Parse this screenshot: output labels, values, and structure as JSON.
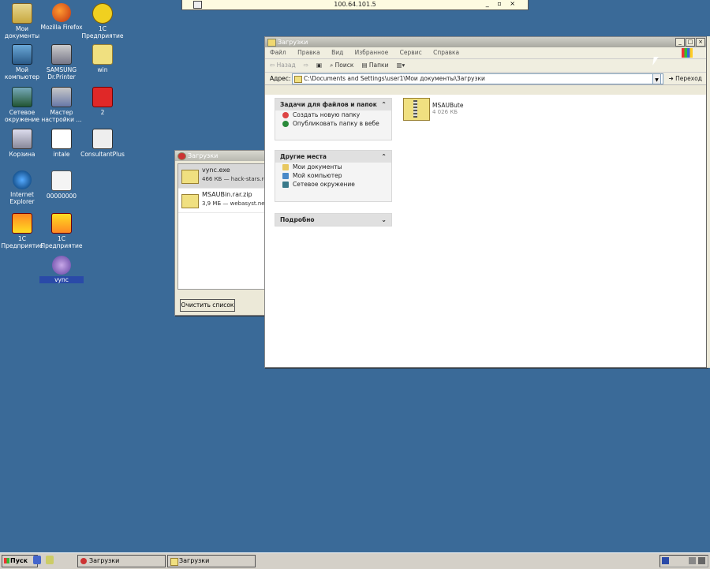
{
  "remote_bar": {
    "address": "100.64.101.5",
    "buttons": "_ ▫ ×"
  },
  "desktop_icons": [
    {
      "label": "Мои документы"
    },
    {
      "label": "Mozilla Firefox"
    },
    {
      "label": "1С Предприятие"
    },
    {
      "label": "Мой компьютер"
    },
    {
      "label": "SAMSUNG Dr.Printer"
    },
    {
      "label": "win"
    },
    {
      "label": "Сетевое окружение"
    },
    {
      "label": "Мастер настройки ..."
    },
    {
      "label": "2"
    },
    {
      "label": "Корзина"
    },
    {
      "label": "intale"
    },
    {
      "label": "ConsultantPlus"
    },
    {
      "label": "Internet Explorer"
    },
    {
      "label": "00000000"
    },
    {
      "label": "1С Предприятие"
    },
    {
      "label": "1С Предприятие"
    },
    {
      "label": "vync"
    }
  ],
  "downloads_window": {
    "title": "Загрузки",
    "items": [
      {
        "name": "vync.exe",
        "meta": "466 КБ — hack-stars.ru"
      },
      {
        "name": "MSAUBin.rar.zip",
        "meta": "3,9 МБ — webasyst.net"
      }
    ],
    "clear_label": "Очистить список"
  },
  "explorer": {
    "title": "Загрузки",
    "menu": [
      "Файл",
      "Правка",
      "Вид",
      "Избранное",
      "Сервис",
      "Справка"
    ],
    "toolbar": {
      "back": "Назад",
      "search": "Поиск",
      "folders": "Папки"
    },
    "address_label": "Адрес:",
    "address_value": "C:\\Documents and Settings\\user1\\Мои документы\\Загрузки",
    "go_label": "Переход",
    "panels": {
      "tasks": {
        "title": "Задачи для файлов и папок",
        "items": [
          "Создать новую папку",
          "Опубликовать папку в вебе"
        ]
      },
      "places": {
        "title": "Другие места",
        "items": [
          "Мои документы",
          "Мой компьютер",
          "Сетевое окружение"
        ]
      },
      "details": {
        "title": "Подробно"
      }
    },
    "file": {
      "name": "MSAUBute",
      "size": "4 026 КБ"
    }
  },
  "taskbar": {
    "start_label": "Пуск",
    "tasks": [
      "Загрузки",
      "Загрузки"
    ]
  }
}
